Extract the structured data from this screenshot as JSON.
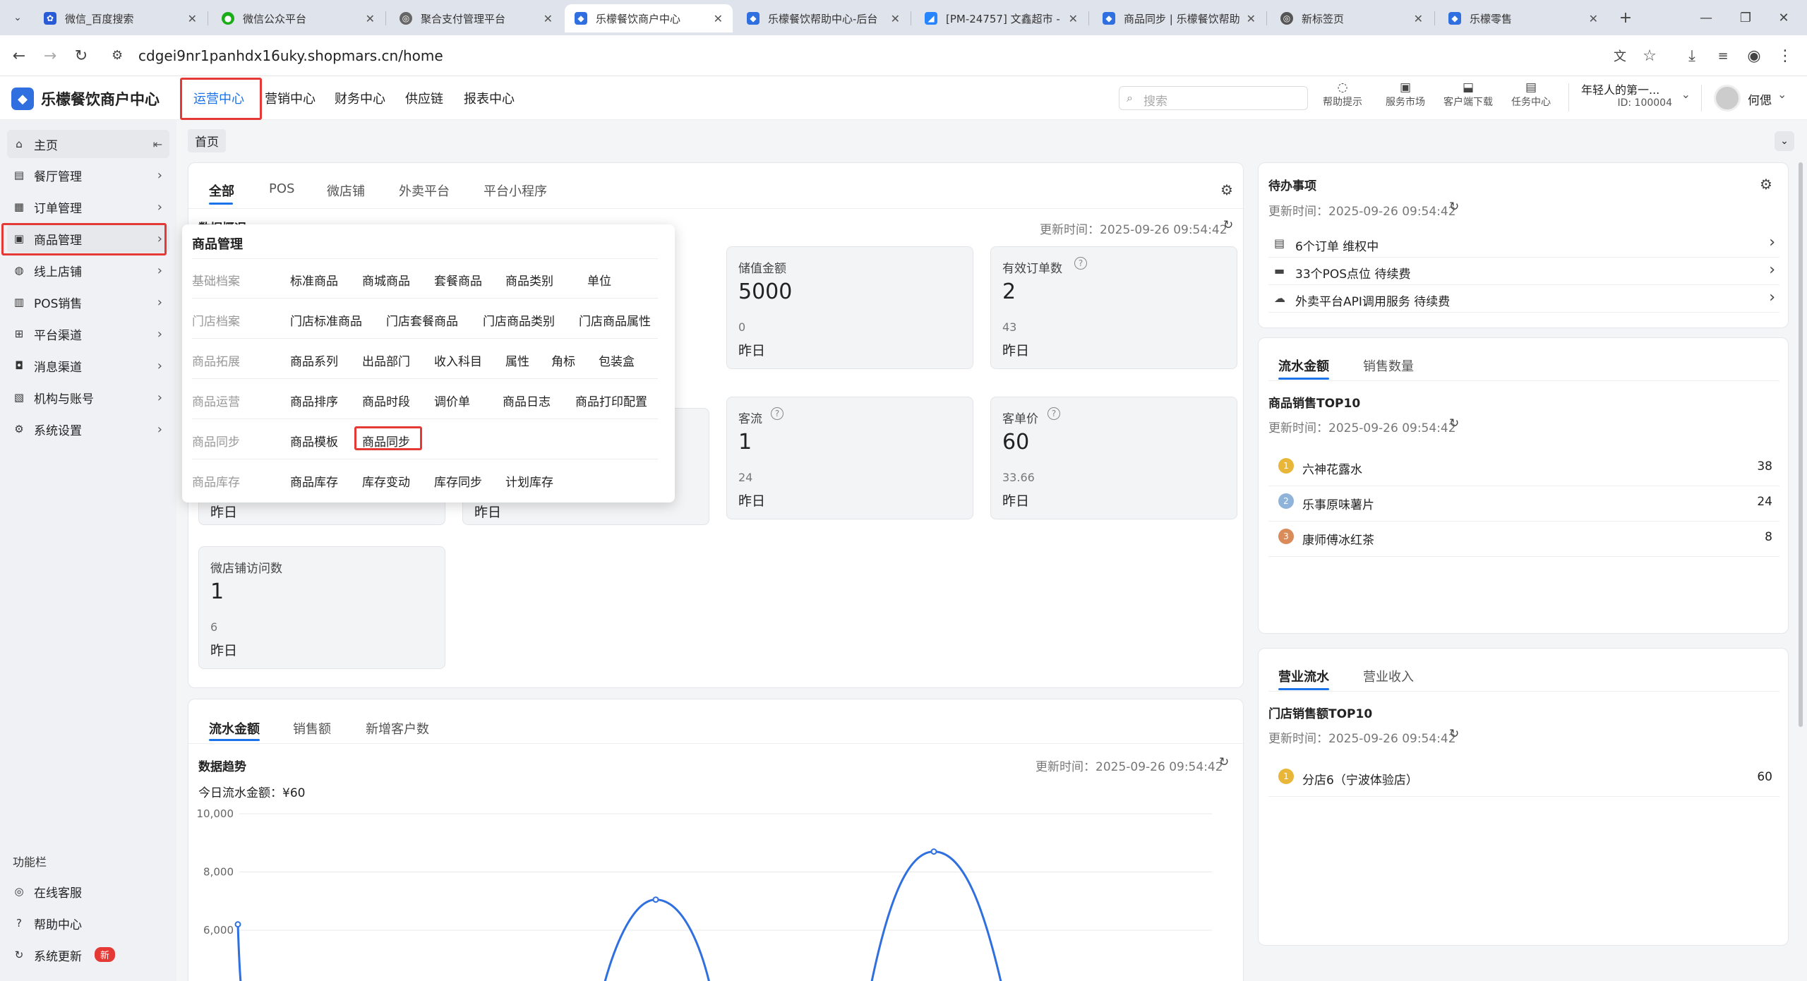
{
  "browser": {
    "tabs": [
      {
        "title": "微信_百度搜索",
        "icon": "baidu-icon"
      },
      {
        "title": "微信公众平台",
        "icon": "wechat-icon"
      },
      {
        "title": "聚合支付管理平台",
        "icon": "globe-icon"
      },
      {
        "title": "乐檬餐饮商户中心",
        "icon": "lemon-icon"
      },
      {
        "title": "乐檬餐饮帮助中心-后台",
        "icon": "lemon-icon"
      },
      {
        "title": "[PM-24757] 文鑫超市 -",
        "icon": "jira-icon"
      },
      {
        "title": "商品同步 | 乐檬餐饮帮助",
        "icon": "lemon-icon"
      },
      {
        "title": "新标签页",
        "icon": "chrome-icon"
      },
      {
        "title": "乐檬零售",
        "icon": "lemon-icon"
      }
    ],
    "url": "cdgei9nr1panhdx16uky.shopmars.cn/home"
  },
  "header": {
    "logo_text": "乐檬餐饮商户中心",
    "nav": [
      "运营中心",
      "营销中心",
      "财务中心",
      "供应链",
      "报表中心"
    ],
    "search_placeholder": "搜索",
    "tools": [
      "帮助提示",
      "服务市场",
      "客户端下载",
      "任务中心"
    ],
    "org_name": "年轻人的第一...",
    "org_id": "ID: 100004",
    "user_name": "何偲"
  },
  "sidebar": {
    "items": [
      "主页",
      "餐厅管理",
      "订单管理",
      "商品管理",
      "线上店铺",
      "POS销售",
      "平台渠道",
      "消息渠道",
      "机构与账号",
      "系统设置"
    ],
    "func_title": "功能栏",
    "func_items": [
      "在线客服",
      "帮助中心",
      "系统更新"
    ],
    "new_badge": "新"
  },
  "breadcrumb": "首页",
  "overview": {
    "tabs": [
      "全部",
      "POS",
      "微店铺",
      "外卖平台",
      "平台小程序"
    ],
    "section_title": "数据概况",
    "update_time": "更新时间：2025-09-26 09:54:42",
    "cards": [
      {
        "label": "储值金额",
        "value": "5000",
        "sub": "0",
        "period": "昨日"
      },
      {
        "label": "有效订单数",
        "value": "2",
        "sub": "43",
        "period": "昨日"
      },
      {
        "label": "客流",
        "value": "1",
        "sub": "24",
        "period": "昨日"
      },
      {
        "label": "客单价",
        "value": "60",
        "sub": "33.66",
        "period": "昨日"
      },
      {
        "label": "微店铺访问数",
        "value": "1",
        "sub": "6",
        "period": "昨日"
      }
    ],
    "hidden_period_a": "昨日",
    "hidden_period_b": "昨日"
  },
  "menu": {
    "title": "商品管理",
    "rows": [
      {
        "category": "基础档案",
        "links": [
          "标准商品",
          "商城商品",
          "套餐商品",
          "商品类别",
          "单位"
        ]
      },
      {
        "category": "门店档案",
        "links": [
          "门店标准商品",
          "门店套餐商品",
          "门店商品类别",
          "门店商品属性"
        ]
      },
      {
        "category": "商品拓展",
        "links": [
          "商品系列",
          "出品部门",
          "收入科目",
          "属性",
          "角标",
          "包装盒"
        ]
      },
      {
        "category": "商品运营",
        "links": [
          "商品排序",
          "商品时段",
          "调价单",
          "商品日志",
          "商品打印配置"
        ]
      },
      {
        "category": "商品同步",
        "links": [
          "商品模板",
          "商品同步"
        ]
      },
      {
        "category": "商品库存",
        "links": [
          "商品库存",
          "库存变动",
          "库存同步",
          "计划库存"
        ]
      }
    ]
  },
  "trend": {
    "tabs": [
      "流水金额",
      "销售额",
      "新增客户数"
    ],
    "title": "数据趋势",
    "update_time": "更新时间：2025-09-26 09:54:42",
    "today_label": "今日流水金额：¥60"
  },
  "chart_data": {
    "type": "line",
    "y_ticks": [
      "10,000",
      "8,000",
      "6,000"
    ],
    "ylim": [
      6000,
      10000
    ],
    "series": [
      {
        "values": [
          6200,
          7050,
          8700
        ]
      }
    ],
    "color": "#2f6fe0"
  },
  "todo": {
    "title": "待办事项",
    "update_time": "更新时间：2025-09-26 09:54:42",
    "items": [
      "6个订单 维权中",
      "33个POS点位 待续费",
      "外卖平台API调用服务 待续费"
    ]
  },
  "top_goods": {
    "tabs": [
      "流水金额",
      "销售数量"
    ],
    "title": "商品销售TOP10",
    "update_time": "更新时间：2025-09-26 09:54:42",
    "items": [
      {
        "rank": "1",
        "name": "六神花露水",
        "value": "38"
      },
      {
        "rank": "2",
        "name": "乐事原味薯片",
        "value": "24"
      },
      {
        "rank": "3",
        "name": "康师傅冰红茶",
        "value": "8"
      }
    ]
  },
  "top_stores": {
    "tabs": [
      "营业流水",
      "营业收入"
    ],
    "title": "门店销售额TOP10",
    "update_time": "更新时间：2025-09-26 09:54:42",
    "items": [
      {
        "rank": "1",
        "name": "分店6（宁波体验店）",
        "value": "60"
      }
    ]
  },
  "colors": {
    "accent": "#1a73e8",
    "highlight": "#e53935",
    "gold": "#e8b73a",
    "silver": "#8fb3d9",
    "bronze": "#d98b5a"
  }
}
